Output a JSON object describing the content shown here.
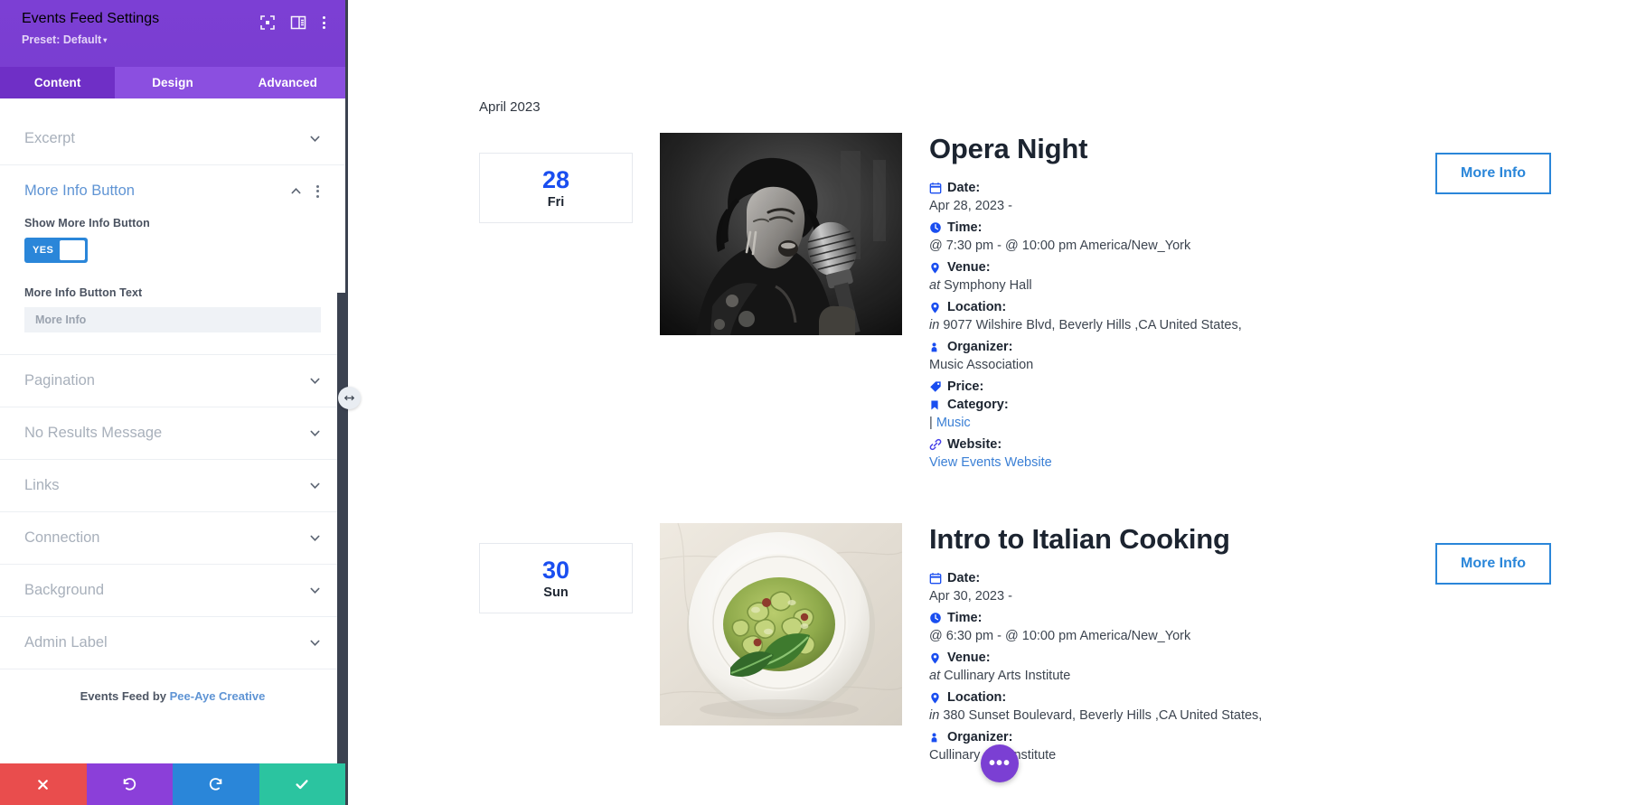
{
  "sidebar": {
    "title": "Events Feed Settings",
    "preset_label": "Preset: Default",
    "preset_caret": "▾",
    "tabs": [
      {
        "label": "Content",
        "active": true
      },
      {
        "label": "Design",
        "active": false
      },
      {
        "label": "Advanced",
        "active": false
      }
    ],
    "sections": [
      {
        "label": "Excerpt",
        "open": false
      },
      {
        "label": "More Info Button",
        "open": true
      },
      {
        "label": "Pagination",
        "open": false
      },
      {
        "label": "No Results Message",
        "open": false
      },
      {
        "label": "Links",
        "open": false
      },
      {
        "label": "Connection",
        "open": false
      },
      {
        "label": "Background",
        "open": false
      },
      {
        "label": "Admin Label",
        "open": false
      }
    ],
    "more_info_section": {
      "show_button_label": "Show More Info Button",
      "toggle_value": "YES",
      "button_text_label": "More Info Button Text",
      "button_text_value": "",
      "button_text_placeholder": "More Info"
    },
    "credit_prefix": "Events Feed by ",
    "credit_link": "Pee-Aye Creative",
    "footer_buttons": [
      {
        "name": "close",
        "icon": "x-icon",
        "color": "#e94d4d"
      },
      {
        "name": "undo",
        "icon": "undo-icon",
        "color": "#8b3fd9"
      },
      {
        "name": "redo",
        "icon": "redo-icon",
        "color": "#2a86d9"
      },
      {
        "name": "save",
        "icon": "check-icon",
        "color": "#2bc4a0"
      }
    ],
    "header_icons": [
      "fullscreen-icon",
      "layout-icon",
      "kebab-menu-icon"
    ],
    "colors": {
      "header_purple": "#7b3fd3",
      "tab_active": "#6f2fc6",
      "toggle_blue": "#2a86d9",
      "link_blue": "#5f94d4"
    }
  },
  "preview": {
    "month_label": "April 2023",
    "events": [
      {
        "day": "28",
        "dow": "Fri",
        "title": "Opera Night",
        "thumb": "singer-microphone-bw",
        "meta": [
          {
            "icon": "calendar-icon",
            "label": "Date:",
            "value": "Apr 28, 2023 -",
            "style": "plain"
          },
          {
            "icon": "clock-icon",
            "label": "Time:",
            "value": "@ 7:30 pm - @ 10:00 pm America/New_York",
            "style": "plain"
          },
          {
            "icon": "pin-icon",
            "label": "Venue:",
            "prefix": "at",
            "value": "Symphony Hall",
            "style": "prefix-italic"
          },
          {
            "icon": "pin-icon",
            "label": "Location:",
            "prefix": "in",
            "value": "9077 Wilshire Blvd, Beverly Hills ,CA United States,",
            "style": "prefix-italic"
          },
          {
            "icon": "person-icon",
            "label": "Organizer:",
            "value": "Music Association",
            "style": "plain"
          },
          {
            "icon": "tag-icon",
            "label": "Price:",
            "value": "",
            "style": "plain"
          },
          {
            "icon": "bookmark-icon",
            "label": "Category:",
            "prefix": "|",
            "value": "Music",
            "style": "link"
          },
          {
            "icon": "link-icon",
            "label": "Website:",
            "value": "View Events Website",
            "style": "link-full"
          }
        ],
        "button_label": "More Info"
      },
      {
        "day": "30",
        "dow": "Sun",
        "title": "Intro to Italian Cooking",
        "thumb": "pasta-plate",
        "meta": [
          {
            "icon": "calendar-icon",
            "label": "Date:",
            "value": "Apr 30, 2023 -",
            "style": "plain"
          },
          {
            "icon": "clock-icon",
            "label": "Time:",
            "value": "@ 6:30 pm - @ 10:00 pm America/New_York",
            "style": "plain"
          },
          {
            "icon": "pin-icon",
            "label": "Venue:",
            "prefix": "at",
            "value": "Cullinary Arts Institute",
            "style": "prefix-italic"
          },
          {
            "icon": "pin-icon",
            "label": "Location:",
            "prefix": "in",
            "value": "380 Sunset Boulevard, Beverly Hills ,CA United States,",
            "style": "prefix-italic"
          },
          {
            "icon": "person-icon",
            "label": "Organizer:",
            "value": "Cullinary Arts Institute",
            "style": "plain"
          }
        ],
        "button_label": "More Info"
      }
    ],
    "fab_label": "•••"
  }
}
